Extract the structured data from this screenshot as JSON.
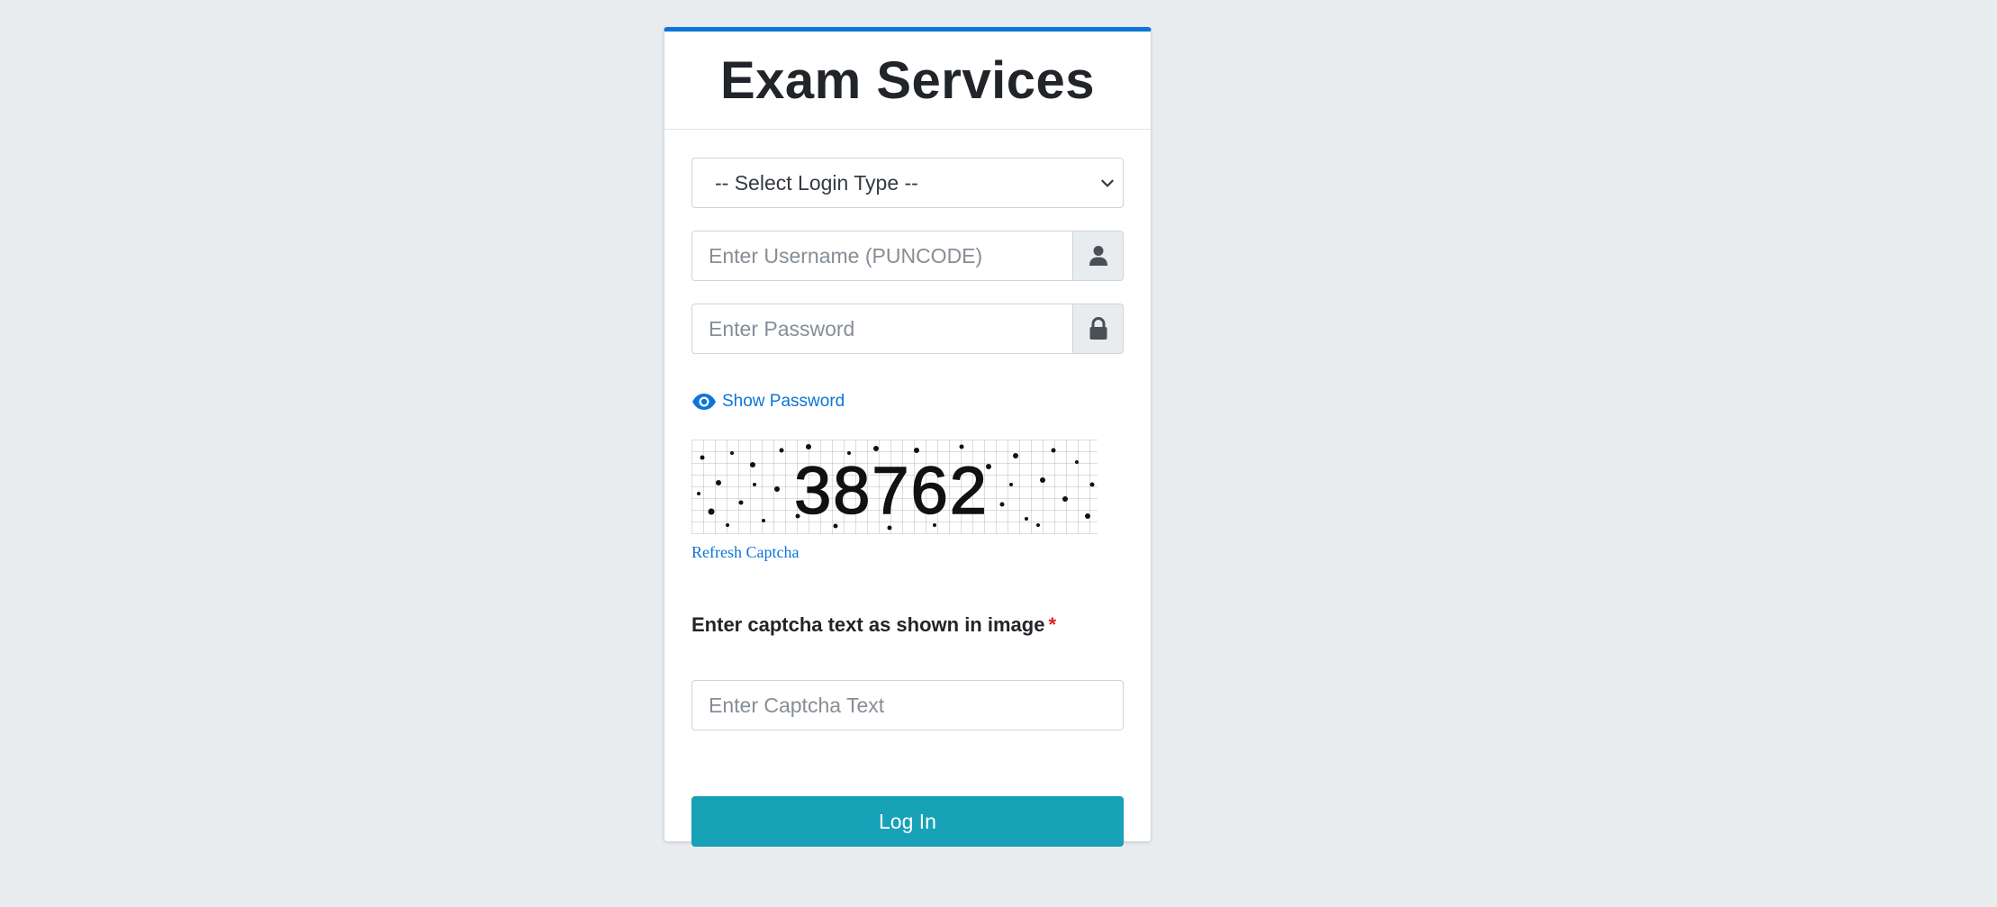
{
  "header": {
    "title": "Exam Services"
  },
  "form": {
    "login_type": {
      "selected": "-- Select Login Type --"
    },
    "username": {
      "placeholder": "Enter Username (PUNCODE)",
      "icon": "user-icon"
    },
    "password": {
      "placeholder": "Enter Password",
      "icon": "lock-icon"
    },
    "show_password": {
      "label": "Show Password",
      "icon": "eye-icon"
    },
    "captcha": {
      "text": "38762",
      "refresh_label": "Refresh Captcha"
    },
    "captcha_field": {
      "label": "Enter captcha text as shown in image",
      "required_mark": "*",
      "placeholder": "Enter Captcha Text"
    },
    "submit_label": "Log In"
  },
  "colors": {
    "accent": "#0d74d8",
    "button": "#17a2b8",
    "background": "#e9ecef",
    "required": "#e02020"
  }
}
